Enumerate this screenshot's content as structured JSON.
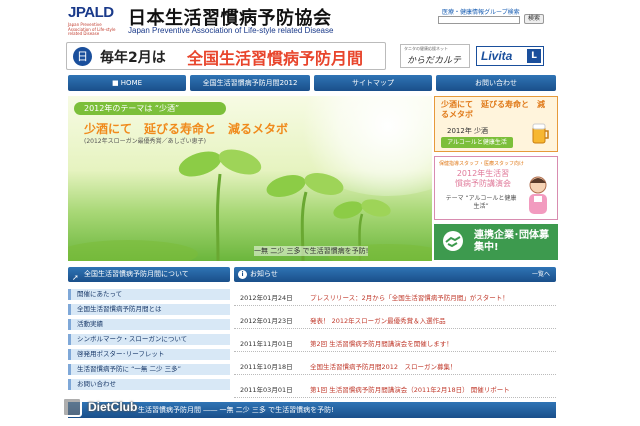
{
  "header": {
    "logo": "JPALD",
    "logo_sub": "Japan Preventive Association of Life-style related Disease",
    "org_name_jp": "日本生活習慣病予防協会",
    "org_name_en": "Japan Preventive Association of Life-style related Disease",
    "top_link": "医療・健康情報グループ検索",
    "search_button": "検索"
  },
  "campaign": {
    "icon": "日",
    "prefix": "毎年2月は",
    "title": "全国生活習慣病予防月間"
  },
  "partners": {
    "karada_small": "タニタの健康応援ネット",
    "karada": "からだカルテ",
    "livita": "Livita",
    "livita_badge": "L"
  },
  "nav": [
    "HOME",
    "全国生活習慣病予防月間2012",
    "サイトマップ",
    "お問い合わせ"
  ],
  "hero": {
    "theme": "2012年のテーマは “少酒”",
    "slogan": "少酒にて　延びる寿命と　減るメタボ",
    "note": "(2012年スローガン最優秀賞／あしざい恵子)",
    "caption": "一無 二少 三多 で生活習慣病を予防!"
  },
  "side_boxes": {
    "alcohol_title": "少酒にて　延びる寿命と　減るメタボ",
    "alcohol_year": "2012年 少酒",
    "alcohol_tag": "アルコールと健康生活",
    "lecture_top": "保健指導スタッフ・医療スタッフ向け",
    "lecture_title": "2012年生活習慣病予防講演会",
    "lecture_sub": "テーマ “アルコールと健康生活”",
    "partner_label": "連携企業･団体募集中!"
  },
  "sidebar": {
    "header": "全国生活習慣病予防月間について",
    "items": [
      "開催にあたって",
      "全国生活習慣病予防月間とは",
      "活動実績",
      "シンボルマーク・スローガンについて",
      "啓発用ポスター･リーフレット",
      "生活習慣病予防に “一無 二少 三多”",
      "お問い合わせ"
    ]
  },
  "news": {
    "header": "お知らせ",
    "more": "一覧へ",
    "items": [
      {
        "date": "2012年01月24日",
        "text": "プレスリリース：2月から「全国生活習慣病予防月間」がスタート！"
      },
      {
        "date": "2012年01月23日",
        "text": "発表！ 2012年スローガン最優秀賞＆入選作品"
      },
      {
        "date": "2011年11月01日",
        "text": "第2回 生活習慣病予防月間講演会を開催します！"
      },
      {
        "date": "2011年10月18日",
        "text": "全国生活習慣病予防月間2012　スローガン募集！"
      },
      {
        "date": "2011年03月01日",
        "text": "第1回 生活習慣病予防月間講演会（2011年2月18日） 開催リポート"
      }
    ]
  },
  "footer": {
    "text": "生活習慣病予防月間 ―― 一無 二少 三多 で生活習慣病を予防!"
  },
  "watermark": "DietClub",
  "colors": {
    "nav_blue": "#1a4f8a",
    "accent_orange": "#e8452c",
    "leaf_green": "#7cbf3a"
  }
}
